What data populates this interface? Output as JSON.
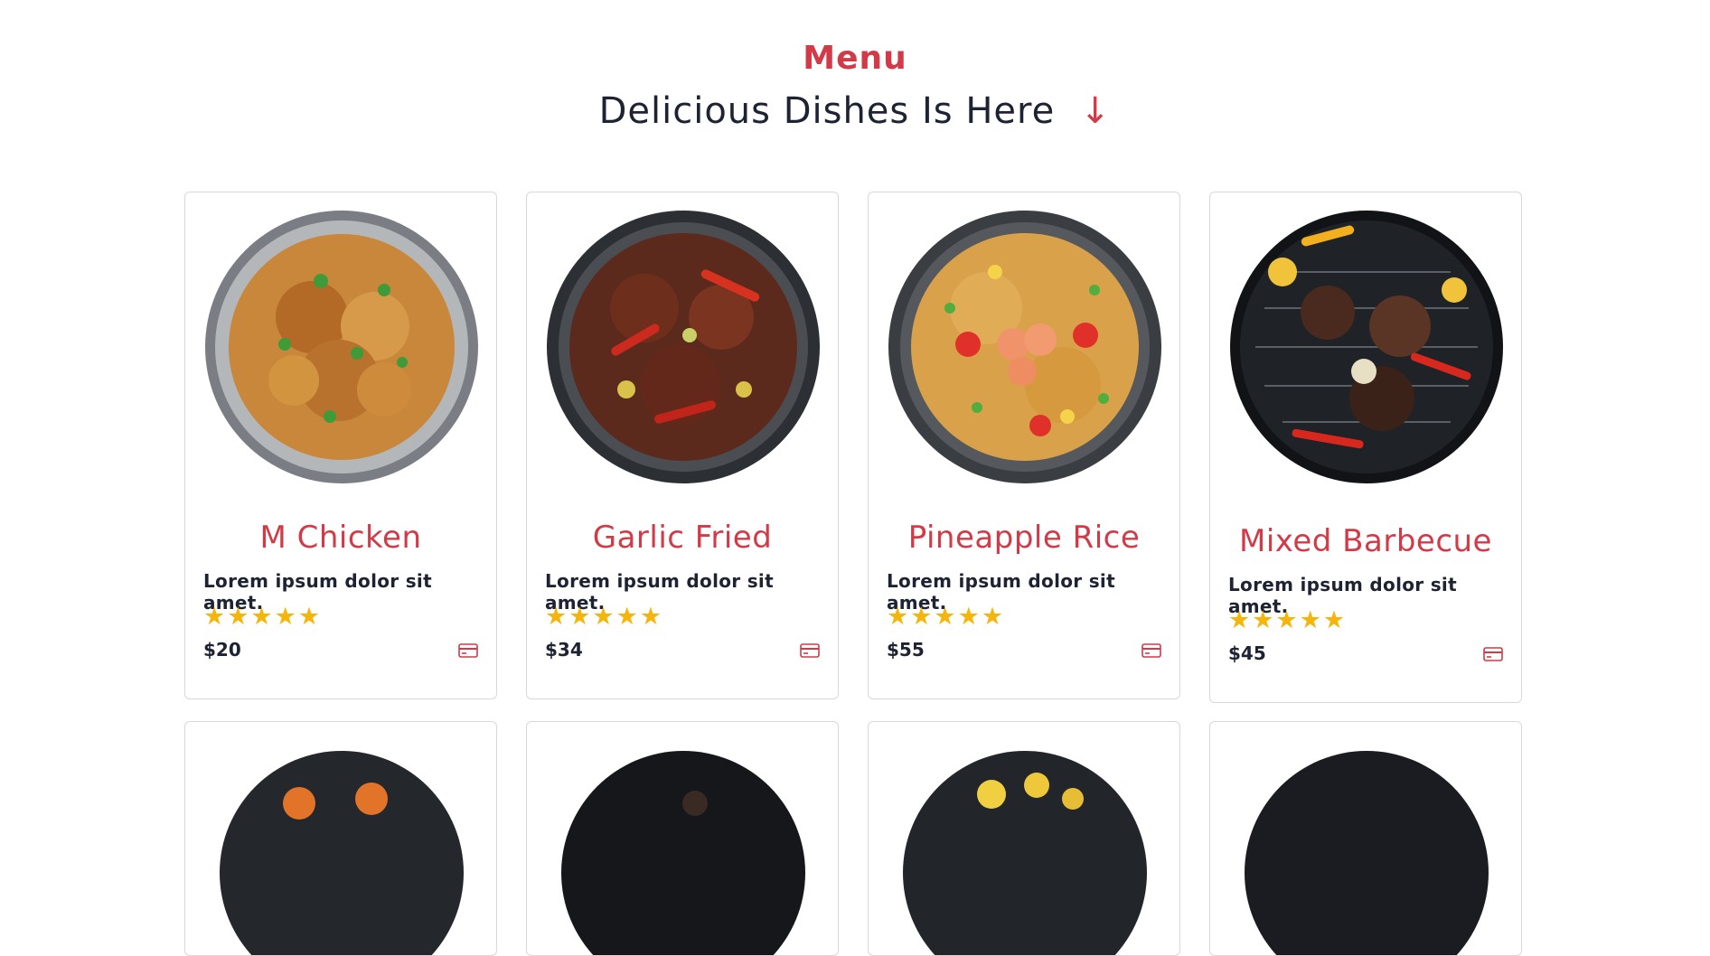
{
  "header": {
    "label": "Menu",
    "title": "Delicious Dishes Is Here",
    "arrow": "↓"
  },
  "cards": [
    {
      "name": "M Chicken",
      "desc": "Lorem ipsum dolor sit amet.",
      "stars": "★★★★★",
      "rating": 5,
      "price": "$20",
      "icon": "credit-card-icon"
    },
    {
      "name": "Garlic Fried",
      "desc": "Lorem ipsum dolor sit amet.",
      "stars": "★★★★★",
      "rating": 5,
      "price": "$34",
      "icon": "credit-card-icon"
    },
    {
      "name": "Pineapple Rice",
      "desc": "Lorem ipsum dolor sit amet.",
      "stars": "★★★★★",
      "rating": 5,
      "price": "$55",
      "icon": "credit-card-icon"
    },
    {
      "name": "Mixed Barbecue",
      "desc": "Lorem ipsum dolor sit amet.",
      "stars": "★★★★★",
      "rating": 5,
      "price": "$45",
      "icon": "credit-card-icon"
    }
  ],
  "colors": {
    "accent": "#d23a48",
    "text": "#1d2332",
    "star": "#f5b50a",
    "border": "#d8d8d8"
  }
}
